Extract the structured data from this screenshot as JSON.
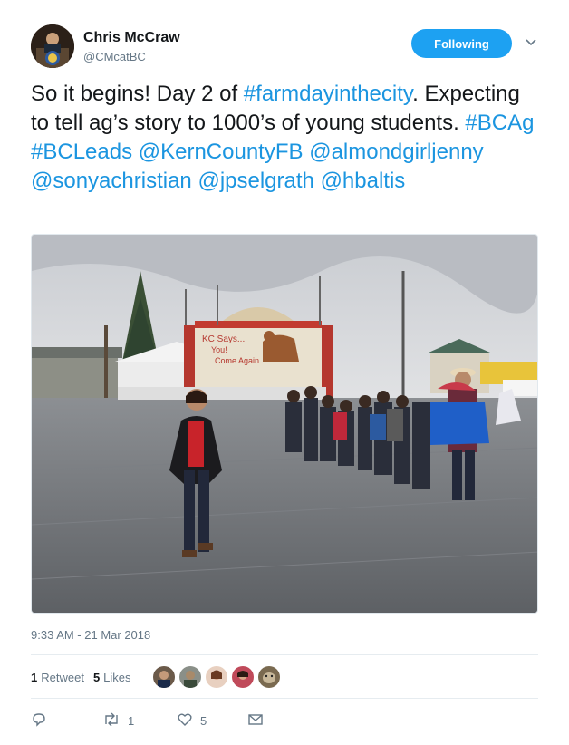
{
  "author": {
    "name": "Chris McCraw",
    "handle": "@CMcatBC"
  },
  "follow_button_label": "Following",
  "tweet": {
    "segments": [
      {
        "text": "So it begins! Day 2 of ",
        "link": false
      },
      {
        "text": "#farmdayinthecity",
        "link": true
      },
      {
        "text": ". Expecting to tell ag’s story to 1000’s of young students. ",
        "link": false
      },
      {
        "text": "#BCAg",
        "link": true
      },
      {
        "text": " ",
        "link": false
      },
      {
        "text": "#BCLeads",
        "link": true
      },
      {
        "text": " ",
        "link": false
      },
      {
        "text": "@KernCountyFB",
        "link": true
      },
      {
        "text": " ",
        "link": false
      },
      {
        "text": "@almondgirljenny",
        "link": true
      },
      {
        "text": " ",
        "link": false
      },
      {
        "text": "@sonyachristian",
        "link": true
      },
      {
        "text": " ",
        "link": false
      },
      {
        "text": "@jpselgrath",
        "link": true
      },
      {
        "text": " ",
        "link": false
      },
      {
        "text": "@hbaltis",
        "link": true
      }
    ]
  },
  "photo": {
    "sign_text": [
      "KC Says...",
      "You!",
      "Come Again"
    ],
    "icon": "tweet-photo"
  },
  "timestamp": "9:33 AM - 21 Mar 2018",
  "stats": {
    "retweets_count": "1",
    "retweets_label": "Retweet",
    "likes_count": "5",
    "likes_label": "Likes"
  },
  "actions": {
    "reply_icon": "reply-icon",
    "retweet_icon": "retweet-icon",
    "retweet_count": "1",
    "like_icon": "heart-icon",
    "like_count": "5",
    "dm_icon": "envelope-icon"
  },
  "colors": {
    "accent": "#1da1f2",
    "link": "#1b95e0",
    "muted": "#657786"
  }
}
